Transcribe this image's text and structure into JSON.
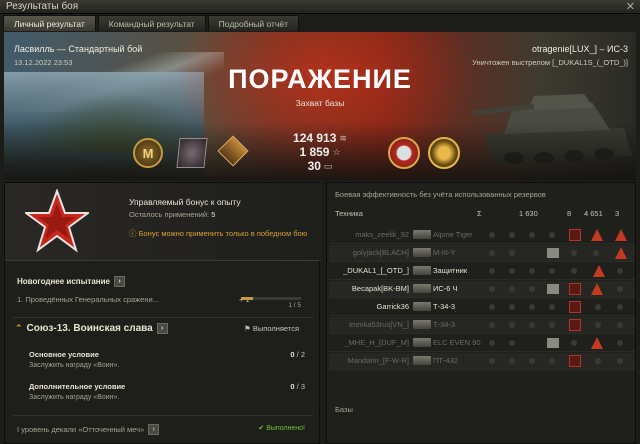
{
  "window": {
    "title": "Результаты боя",
    "close_glyph": "✕"
  },
  "tabs": [
    {
      "label": "Личный результат",
      "active": true
    },
    {
      "label": "Командный результат",
      "active": false
    },
    {
      "label": "Подробный отчёт",
      "active": false
    }
  ],
  "banner": {
    "map_mode": "Ласвилль — Стандартный бой",
    "datetime": "13.12.2022 23:53",
    "player": "otragenie[LUX_] – ИС-3",
    "killed_by": "Уничтожен выстрелом [_DUKAL1S_(_OTD_)]",
    "result": "ПОРАЖЕНИЕ",
    "reason": "Захват базы"
  },
  "stats": {
    "credits": "124 913",
    "credits_icon": "credits-icon",
    "xp": "1 859",
    "xp_icon": "star",
    "bonds": "30",
    "bonds_icon": "bonds-icon"
  },
  "bonus": {
    "title": "Управляемый бонус к опыту",
    "remaining_label": "Осталось применений:",
    "remaining_value": "5",
    "warning": "Бонус можно применить только в победном бою"
  },
  "new_challenge": {
    "title": "Новогоднее испытание",
    "item": "1. Проведённых Генеральных сражени...",
    "gain": "+ 1",
    "progress_text": "1 / 5",
    "progress_fraction": 0.2
  },
  "mission": {
    "title": "Союз-13. Воинская слава",
    "status": "Выполняется",
    "main_cond_title": "Основное условие",
    "main_cond_desc": "Заслужить награду «Воин».",
    "main_cond_progress": "0",
    "main_cond_total": "/ 2",
    "extra_cond_title": "Дополнительное условие",
    "extra_cond_desc": "Заслужить награду «Воин».",
    "extra_cond_progress": "0",
    "extra_cond_total": "/ 3",
    "level_text": "I уровень декали «Отточенный меч»",
    "done_text": "Выполнено!"
  },
  "efficiency": {
    "header": "Боевая эффективность без учёта использованных резервов",
    "col_vehicle": "Техника",
    "col_values": [
      "1 630",
      "8",
      "4 651",
      "3"
    ],
    "rows": [
      {
        "player": "maks_zeelik_92",
        "vehicle": "Alpine Tiger",
        "style": "muted"
      },
      {
        "player": "golyjack[BLACH]",
        "vehicle": "M-III-Y",
        "style": "muted"
      },
      {
        "player": "_DUKAL1_[_OTD_]",
        "vehicle": "Защитник",
        "style": "bright"
      },
      {
        "player": "Becapak[BK-BM]",
        "vehicle": "ИС-6 Ч",
        "style": "bright"
      },
      {
        "player": "Garrick36",
        "vehicle": "Т-34-3",
        "style": "bright"
      },
      {
        "player": "Immka53rus[VN_]",
        "vehicle": "Т-34-3",
        "style": "muted"
      },
      {
        "player": "_MHE_H_[DUF_M]",
        "vehicle": "ELC EVEN 90",
        "style": "muted"
      },
      {
        "player": "Mandarin_[F-W-R]",
        "vehicle": "ПТ-432",
        "style": "muted"
      }
    ],
    "bases_label": "Базы"
  },
  "colors": {
    "accent": "#d8a030",
    "defeat_red": "#b52a1a",
    "done_green": "#6ac43a"
  }
}
